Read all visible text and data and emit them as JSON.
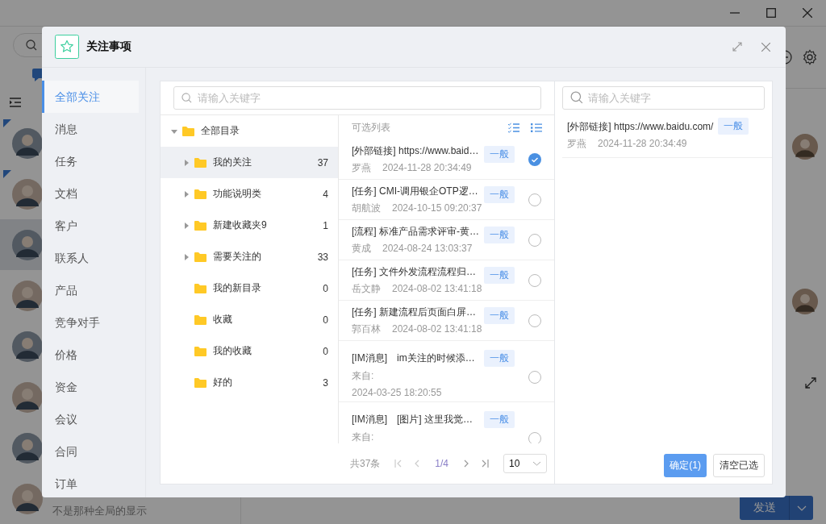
{
  "app": {
    "contacts": [
      {
        "unread": true,
        "selected": false
      },
      {
        "unread": true,
        "selected": false
      },
      {
        "unread": false,
        "selected": true
      },
      {
        "unread": false,
        "selected": false
      },
      {
        "unread": false,
        "selected": false
      },
      {
        "unread": false,
        "selected": false
      },
      {
        "unread": false,
        "selected": false
      },
      {
        "unread": false,
        "selected": false,
        "preview": "不是那种全局的显示"
      }
    ],
    "send_button": "发送"
  },
  "dialog": {
    "title": "关注事项",
    "nav": [
      {
        "label": "全部关注",
        "selected": true
      },
      {
        "label": "消息",
        "selected": false
      },
      {
        "label": "任务",
        "selected": false
      },
      {
        "label": "文档",
        "selected": false
      },
      {
        "label": "客户",
        "selected": false
      },
      {
        "label": "联系人",
        "selected": false
      },
      {
        "label": "产品",
        "selected": false
      },
      {
        "label": "竞争对手",
        "selected": false
      },
      {
        "label": "价格",
        "selected": false
      },
      {
        "label": "资金",
        "selected": false
      },
      {
        "label": "会议",
        "selected": false
      },
      {
        "label": "合同",
        "selected": false
      },
      {
        "label": "订单",
        "selected": false
      }
    ],
    "search": {
      "placeholder": "请输入关键字"
    },
    "tree": {
      "label": "全部目录",
      "expanded": true,
      "children": [
        {
          "label": "我的关注",
          "count": "37",
          "kind": "expandable",
          "selected": true
        },
        {
          "label": "功能说明类",
          "count": "4",
          "kind": "expandable",
          "selected": false
        },
        {
          "label": "新建收藏夹9",
          "count": "1",
          "kind": "expandable",
          "selected": false
        },
        {
          "label": "需要关注的",
          "count": "33",
          "kind": "expandable",
          "selected": false
        },
        {
          "label": "我的新目录",
          "count": "0",
          "kind": "leaf",
          "selected": false
        },
        {
          "label": "收藏",
          "count": "0",
          "kind": "leaf",
          "selected": false
        },
        {
          "label": "我的收藏",
          "count": "0",
          "kind": "leaf",
          "selected": false
        },
        {
          "label": "好的",
          "count": "3",
          "kind": "leaf",
          "selected": false
        }
      ]
    },
    "list": {
      "title": "可选列表",
      "items": [
        {
          "kind": "record",
          "title": "[外部链接] https://www.baid…",
          "author": "罗燕",
          "time": "2024-11-28 20:34:49",
          "tag": "一般",
          "selected": true
        },
        {
          "kind": "record",
          "title": "[任务] CMI-调用银企OTP逻…",
          "author": "胡航波",
          "time": "2024-10-15 09:20:37",
          "tag": "一般",
          "selected": false
        },
        {
          "kind": "record",
          "title": "[流程] 标准产品需求评审-黄…",
          "author": "黄成",
          "time": "2024-08-24 13:03:37",
          "tag": "一般",
          "selected": false
        },
        {
          "kind": "record",
          "title": "[任务] 文件外发流程流程归…",
          "author": "岳文静",
          "time": "2024-08-02 13:41:18",
          "tag": "一般",
          "selected": false
        },
        {
          "kind": "record",
          "title": "[任务] 新建流程后页面白屏…",
          "author": "郭百林",
          "time": "2024-08-02 13:41:18",
          "tag": "一般",
          "selected": false
        },
        {
          "kind": "im",
          "category": "[IM消息]",
          "title": "im关注的时候添…",
          "author": "来自:",
          "time": "2024-03-25 18:20:55",
          "tag": "一般",
          "selected": false
        },
        {
          "kind": "im",
          "category": "[IM消息]",
          "title": "[图片] 这里我觉…",
          "author": "来自:",
          "tag": "一般",
          "selected": false
        }
      ]
    },
    "pagination": {
      "total": "共37条",
      "page": "1/4",
      "page_size": "10"
    },
    "selected_panel": {
      "placeholder": "请输入关键字",
      "items": [
        {
          "title": "[外部链接] https://www.baidu.com/",
          "author": "罗燕",
          "time": "2024-11-28 20:34:49",
          "tag": "一般"
        }
      ]
    },
    "buttons": {
      "confirm": "确定(1)",
      "clear": "清空已选"
    }
  }
}
